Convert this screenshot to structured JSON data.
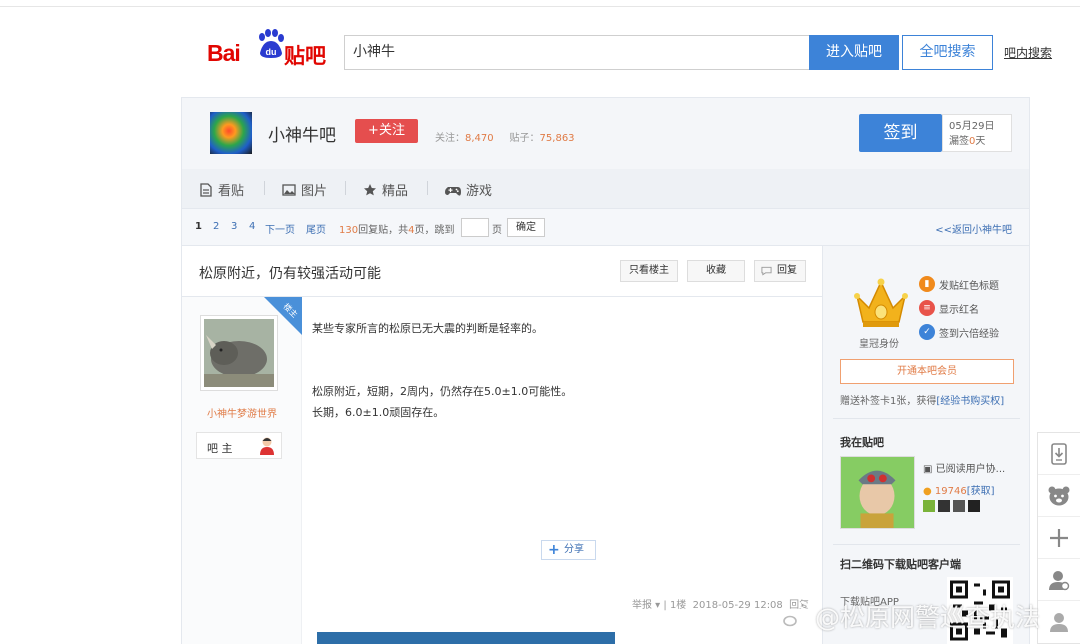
{
  "header": {
    "logo_text_bai": "Bai",
    "logo_text_du": "du",
    "logo_text_tieba": "贴吧",
    "search_value": "小神牛",
    "enter_forum_label": "进入贴吧",
    "search_all_label": "全吧搜索",
    "in_forum_search_label": "吧内搜索"
  },
  "forum": {
    "name": "小神牛吧",
    "follow_label": "+关注",
    "follow_count_label": "关注：",
    "follow_count": "8,470",
    "posts_count_label": "贴子：",
    "posts_count": "75,863",
    "sign_label": "签到",
    "sign_date": "05月29日",
    "sign_missed_prefix": "漏签",
    "sign_missed_count": "0",
    "sign_missed_suffix": "天"
  },
  "nav": {
    "tabs": [
      {
        "label": "看贴",
        "icon": "document-icon"
      },
      {
        "label": "图片",
        "icon": "image-icon"
      },
      {
        "label": "精品",
        "icon": "star-icon"
      },
      {
        "label": "游戏",
        "icon": "gamepad-icon"
      }
    ]
  },
  "pager": {
    "pages": [
      "1",
      "2",
      "3",
      "4"
    ],
    "next_label": "下一页",
    "last_label": "尾页",
    "reply_count": "130",
    "reply_suffix": "回复贴，共",
    "total_pages": "4",
    "jump_prefix": "页，跳到",
    "page_unit": "页",
    "confirm_label": "确定",
    "back_label": "<<返回小神牛吧"
  },
  "post": {
    "title": "松原附近，仍有较强活动可能",
    "only_op_label": "只看楼主",
    "favorite_label": "收藏",
    "reply_label": "回复",
    "op_badge": "楼主",
    "author_name": "小神牛梦游世界",
    "author_role": "吧 主",
    "content_lines": [
      "某些专家所言的松原已无大震的判断是轻率的。",
      "松原附近，短期，2周内，仍然存在5.0±1.0可能性。",
      "长期，6.0±1.0顽固存在。"
    ],
    "share_label": "分享",
    "report_label": "举报",
    "floor_label": "1楼",
    "post_time": "2018-05-29 12:08",
    "reply_link_label": "回复"
  },
  "sidebar": {
    "crown_label": "皇冠身份",
    "perks": [
      {
        "label": "发贴红色标题",
        "color": "#f08a1c"
      },
      {
        "label": "显示红名",
        "color": "#e8534a"
      },
      {
        "label": "签到六倍经验",
        "color": "#3d83d8"
      }
    ],
    "open_vip_label": "开通本吧会员",
    "gift_text": "赠送补签卡1张，获得",
    "gift_link": "[经验书购买权]",
    "my_forum_title": "我在贴吧",
    "read_agreement": "已阅读用户协...",
    "tdou_count": "19746",
    "tdou_get": "[获取]",
    "qr_title": "扫二维码下载贴吧客户端",
    "qr_sub": "下载贴吧APP"
  },
  "watermark": {
    "text": "@松原网警巡查执法"
  }
}
